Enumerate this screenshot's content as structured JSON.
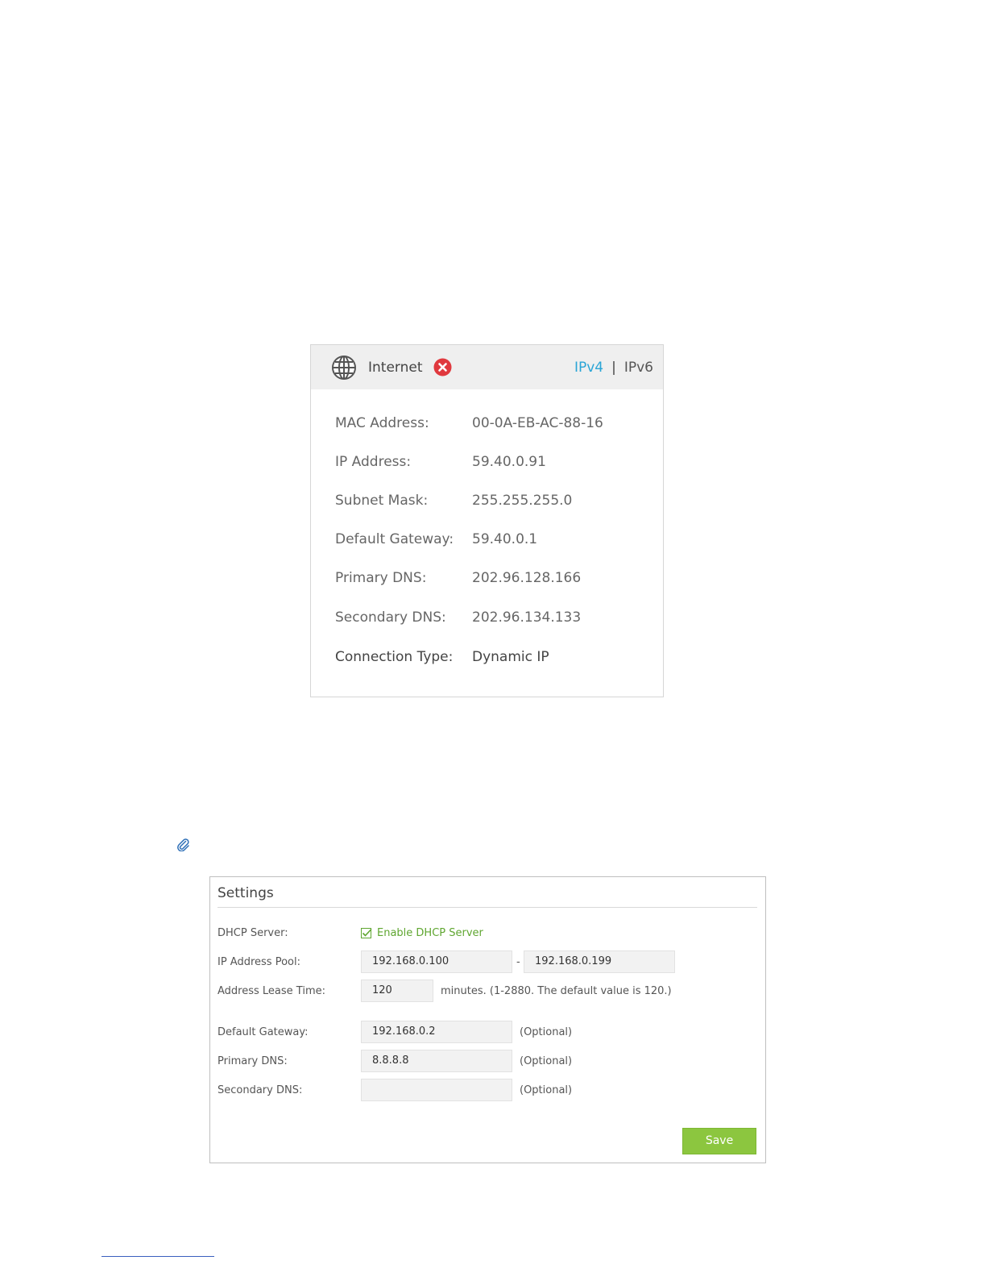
{
  "internet_panel": {
    "title": "Internet",
    "status_icon": "error-x-icon",
    "tabs": {
      "active": "IPv4",
      "separator": "|",
      "other": "IPv6"
    },
    "accent_color": "#2aa5d6",
    "error_color": "#e0393e",
    "rows": [
      {
        "label": "MAC Address:",
        "value": "00-0A-EB-AC-88-16"
      },
      {
        "label": "IP Address:",
        "value": "59.40.0.91"
      },
      {
        "label": "Subnet Mask:",
        "value": "255.255.255.0"
      },
      {
        "label": "Default Gateway:",
        "value": "59.40.0.1"
      },
      {
        "label": "Primary DNS:",
        "value": "202.96.128.166"
      },
      {
        "label": "Secondary DNS:",
        "value": "202.96.134.133"
      },
      {
        "label": "Connection Type:",
        "value": "Dynamic IP"
      }
    ]
  },
  "settings_panel": {
    "title": "Settings",
    "dhcp_server": {
      "label": "DHCP Server:",
      "checkbox_label": "Enable DHCP Server",
      "checked": true
    },
    "ip_pool": {
      "label": "IP Address Pool:",
      "start": "192.168.0.100",
      "separator": "-",
      "end": "192.168.0.199"
    },
    "lease_time": {
      "label": "Address Lease Time:",
      "value": "120",
      "note": "minutes. (1-2880. The default value is 120.)"
    },
    "default_gateway": {
      "label": "Default Gateway:",
      "value": "192.168.0.2",
      "note": "(Optional)"
    },
    "primary_dns": {
      "label": "Primary DNS:",
      "value": "8.8.8.8",
      "note": "(Optional)"
    },
    "secondary_dns": {
      "label": "Secondary DNS:",
      "value": "",
      "note": "(Optional)"
    },
    "save_label": "Save",
    "save_color": "#8cc63f",
    "check_color": "#5fa630"
  }
}
